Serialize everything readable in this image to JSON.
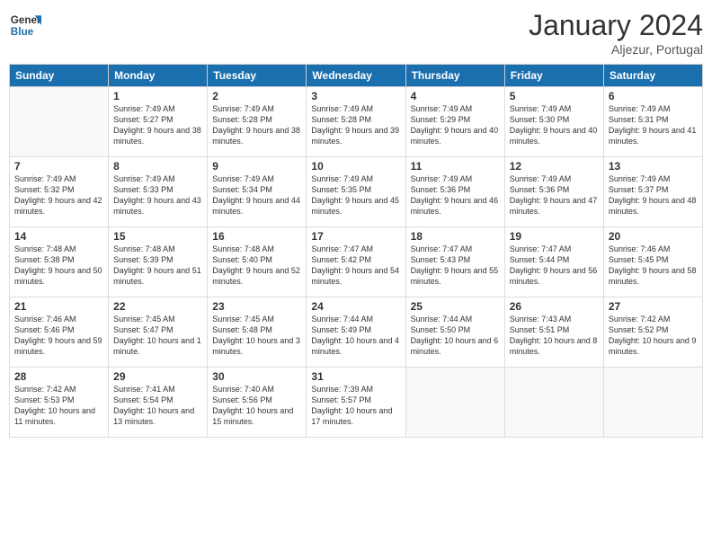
{
  "logo": {
    "line1": "General",
    "line2": "Blue"
  },
  "title": "January 2024",
  "subtitle": "Aljezur, Portugal",
  "headers": [
    "Sunday",
    "Monday",
    "Tuesday",
    "Wednesday",
    "Thursday",
    "Friday",
    "Saturday"
  ],
  "weeks": [
    [
      {
        "day": "",
        "sunrise": "",
        "sunset": "",
        "daylight": ""
      },
      {
        "day": "1",
        "sunrise": "Sunrise: 7:49 AM",
        "sunset": "Sunset: 5:27 PM",
        "daylight": "Daylight: 9 hours and 38 minutes."
      },
      {
        "day": "2",
        "sunrise": "Sunrise: 7:49 AM",
        "sunset": "Sunset: 5:28 PM",
        "daylight": "Daylight: 9 hours and 38 minutes."
      },
      {
        "day": "3",
        "sunrise": "Sunrise: 7:49 AM",
        "sunset": "Sunset: 5:28 PM",
        "daylight": "Daylight: 9 hours and 39 minutes."
      },
      {
        "day": "4",
        "sunrise": "Sunrise: 7:49 AM",
        "sunset": "Sunset: 5:29 PM",
        "daylight": "Daylight: 9 hours and 40 minutes."
      },
      {
        "day": "5",
        "sunrise": "Sunrise: 7:49 AM",
        "sunset": "Sunset: 5:30 PM",
        "daylight": "Daylight: 9 hours and 40 minutes."
      },
      {
        "day": "6",
        "sunrise": "Sunrise: 7:49 AM",
        "sunset": "Sunset: 5:31 PM",
        "daylight": "Daylight: 9 hours and 41 minutes."
      }
    ],
    [
      {
        "day": "7",
        "sunrise": "Sunrise: 7:49 AM",
        "sunset": "Sunset: 5:32 PM",
        "daylight": "Daylight: 9 hours and 42 minutes."
      },
      {
        "day": "8",
        "sunrise": "Sunrise: 7:49 AM",
        "sunset": "Sunset: 5:33 PM",
        "daylight": "Daylight: 9 hours and 43 minutes."
      },
      {
        "day": "9",
        "sunrise": "Sunrise: 7:49 AM",
        "sunset": "Sunset: 5:34 PM",
        "daylight": "Daylight: 9 hours and 44 minutes."
      },
      {
        "day": "10",
        "sunrise": "Sunrise: 7:49 AM",
        "sunset": "Sunset: 5:35 PM",
        "daylight": "Daylight: 9 hours and 45 minutes."
      },
      {
        "day": "11",
        "sunrise": "Sunrise: 7:49 AM",
        "sunset": "Sunset: 5:36 PM",
        "daylight": "Daylight: 9 hours and 46 minutes."
      },
      {
        "day": "12",
        "sunrise": "Sunrise: 7:49 AM",
        "sunset": "Sunset: 5:36 PM",
        "daylight": "Daylight: 9 hours and 47 minutes."
      },
      {
        "day": "13",
        "sunrise": "Sunrise: 7:49 AM",
        "sunset": "Sunset: 5:37 PM",
        "daylight": "Daylight: 9 hours and 48 minutes."
      }
    ],
    [
      {
        "day": "14",
        "sunrise": "Sunrise: 7:48 AM",
        "sunset": "Sunset: 5:38 PM",
        "daylight": "Daylight: 9 hours and 50 minutes."
      },
      {
        "day": "15",
        "sunrise": "Sunrise: 7:48 AM",
        "sunset": "Sunset: 5:39 PM",
        "daylight": "Daylight: 9 hours and 51 minutes."
      },
      {
        "day": "16",
        "sunrise": "Sunrise: 7:48 AM",
        "sunset": "Sunset: 5:40 PM",
        "daylight": "Daylight: 9 hours and 52 minutes."
      },
      {
        "day": "17",
        "sunrise": "Sunrise: 7:47 AM",
        "sunset": "Sunset: 5:42 PM",
        "daylight": "Daylight: 9 hours and 54 minutes."
      },
      {
        "day": "18",
        "sunrise": "Sunrise: 7:47 AM",
        "sunset": "Sunset: 5:43 PM",
        "daylight": "Daylight: 9 hours and 55 minutes."
      },
      {
        "day": "19",
        "sunrise": "Sunrise: 7:47 AM",
        "sunset": "Sunset: 5:44 PM",
        "daylight": "Daylight: 9 hours and 56 minutes."
      },
      {
        "day": "20",
        "sunrise": "Sunrise: 7:46 AM",
        "sunset": "Sunset: 5:45 PM",
        "daylight": "Daylight: 9 hours and 58 minutes."
      }
    ],
    [
      {
        "day": "21",
        "sunrise": "Sunrise: 7:46 AM",
        "sunset": "Sunset: 5:46 PM",
        "daylight": "Daylight: 9 hours and 59 minutes."
      },
      {
        "day": "22",
        "sunrise": "Sunrise: 7:45 AM",
        "sunset": "Sunset: 5:47 PM",
        "daylight": "Daylight: 10 hours and 1 minute."
      },
      {
        "day": "23",
        "sunrise": "Sunrise: 7:45 AM",
        "sunset": "Sunset: 5:48 PM",
        "daylight": "Daylight: 10 hours and 3 minutes."
      },
      {
        "day": "24",
        "sunrise": "Sunrise: 7:44 AM",
        "sunset": "Sunset: 5:49 PM",
        "daylight": "Daylight: 10 hours and 4 minutes."
      },
      {
        "day": "25",
        "sunrise": "Sunrise: 7:44 AM",
        "sunset": "Sunset: 5:50 PM",
        "daylight": "Daylight: 10 hours and 6 minutes."
      },
      {
        "day": "26",
        "sunrise": "Sunrise: 7:43 AM",
        "sunset": "Sunset: 5:51 PM",
        "daylight": "Daylight: 10 hours and 8 minutes."
      },
      {
        "day": "27",
        "sunrise": "Sunrise: 7:42 AM",
        "sunset": "Sunset: 5:52 PM",
        "daylight": "Daylight: 10 hours and 9 minutes."
      }
    ],
    [
      {
        "day": "28",
        "sunrise": "Sunrise: 7:42 AM",
        "sunset": "Sunset: 5:53 PM",
        "daylight": "Daylight: 10 hours and 11 minutes."
      },
      {
        "day": "29",
        "sunrise": "Sunrise: 7:41 AM",
        "sunset": "Sunset: 5:54 PM",
        "daylight": "Daylight: 10 hours and 13 minutes."
      },
      {
        "day": "30",
        "sunrise": "Sunrise: 7:40 AM",
        "sunset": "Sunset: 5:56 PM",
        "daylight": "Daylight: 10 hours and 15 minutes."
      },
      {
        "day": "31",
        "sunrise": "Sunrise: 7:39 AM",
        "sunset": "Sunset: 5:57 PM",
        "daylight": "Daylight: 10 hours and 17 minutes."
      },
      {
        "day": "",
        "sunrise": "",
        "sunset": "",
        "daylight": ""
      },
      {
        "day": "",
        "sunrise": "",
        "sunset": "",
        "daylight": ""
      },
      {
        "day": "",
        "sunrise": "",
        "sunset": "",
        "daylight": ""
      }
    ]
  ]
}
